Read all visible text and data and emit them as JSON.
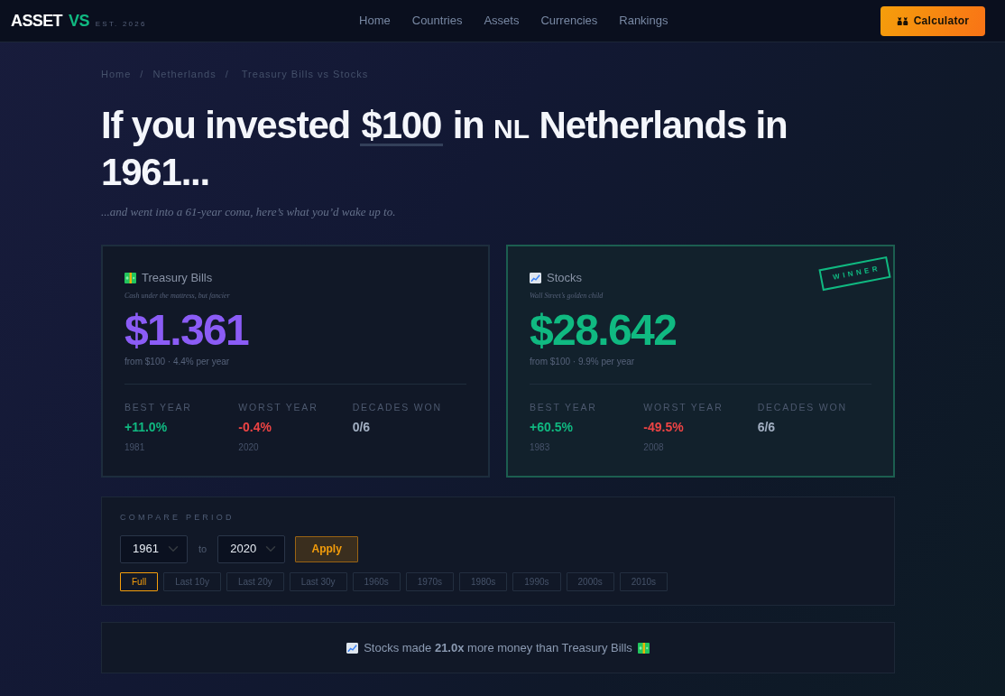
{
  "navbar": {
    "logo": {
      "word": "ASSET",
      "accent": "VS"
    },
    "established": "EST. 2026",
    "links": [
      {
        "label": "Home"
      },
      {
        "label": "Countries"
      },
      {
        "label": "Assets"
      },
      {
        "label": "Currencies"
      },
      {
        "label": "Rankings"
      }
    ],
    "action": "Calculator"
  },
  "breadcrumb": {
    "items": [
      "Home",
      "Netherlands",
      "Treasury Bills vs Stocks"
    ],
    "separators": [
      "/",
      "/"
    ]
  },
  "headline": {
    "before": "If you invested",
    "amount": "$100",
    "middle": "in",
    "flag": "NL",
    "after": "Netherlands in 1961..."
  },
  "subtitle": "...and went into a 61-year coma, here’s what you’d wake up to.",
  "cards": [
    {
      "kind": "bills",
      "name": "Treasury Bills",
      "tagline": "Cash under the mattress, but fancier",
      "value": "$1.361",
      "color": "#8b5cf6",
      "detail": "from $100 · 4.4% per year",
      "winner": false,
      "stats": [
        {
          "kind": "best",
          "label": "BEST YEAR",
          "value": "+11.0%",
          "year": "1981"
        },
        {
          "kind": "worst",
          "label": "WORST YEAR",
          "value": "-0.4%",
          "year": "2020"
        },
        {
          "kind": "decades",
          "label": "DECADES WON",
          "value": "0/6"
        }
      ]
    },
    {
      "kind": "stocks",
      "name": "Stocks",
      "tagline": "Wall Street’s golden child",
      "value": "$28.642",
      "color": "#10b981",
      "detail": "from $100 · 9.9% per year",
      "winner": true,
      "badge": "WINNER",
      "stats": [
        {
          "kind": "best",
          "label": "BEST YEAR",
          "value": "+60.5%",
          "year": "1983"
        },
        {
          "kind": "worst",
          "label": "WORST YEAR",
          "value": "-49.5%",
          "year": "2008"
        },
        {
          "kind": "decades",
          "label": "DECADES WON",
          "value": "6/6"
        }
      ]
    }
  ],
  "compare": {
    "label": "COMPARE PERIOD",
    "start": "1961",
    "joiner": "to",
    "end": "2020",
    "apply": "Apply",
    "presets": [
      {
        "label": "Full",
        "selected": true
      },
      {
        "label": "Last 10y",
        "selected": false
      },
      {
        "label": "Last 20y",
        "selected": false
      },
      {
        "label": "Last 30y",
        "selected": false
      },
      {
        "label": "1960s",
        "selected": false
      },
      {
        "label": "1970s",
        "selected": false
      },
      {
        "label": "1980s",
        "selected": false
      },
      {
        "label": "1990s",
        "selected": false
      },
      {
        "label": "2000s",
        "selected": false
      },
      {
        "label": "2010s",
        "selected": false
      }
    ]
  },
  "summary": {
    "text": "Stocks made **21.0x** more money than Treasury Bills"
  }
}
